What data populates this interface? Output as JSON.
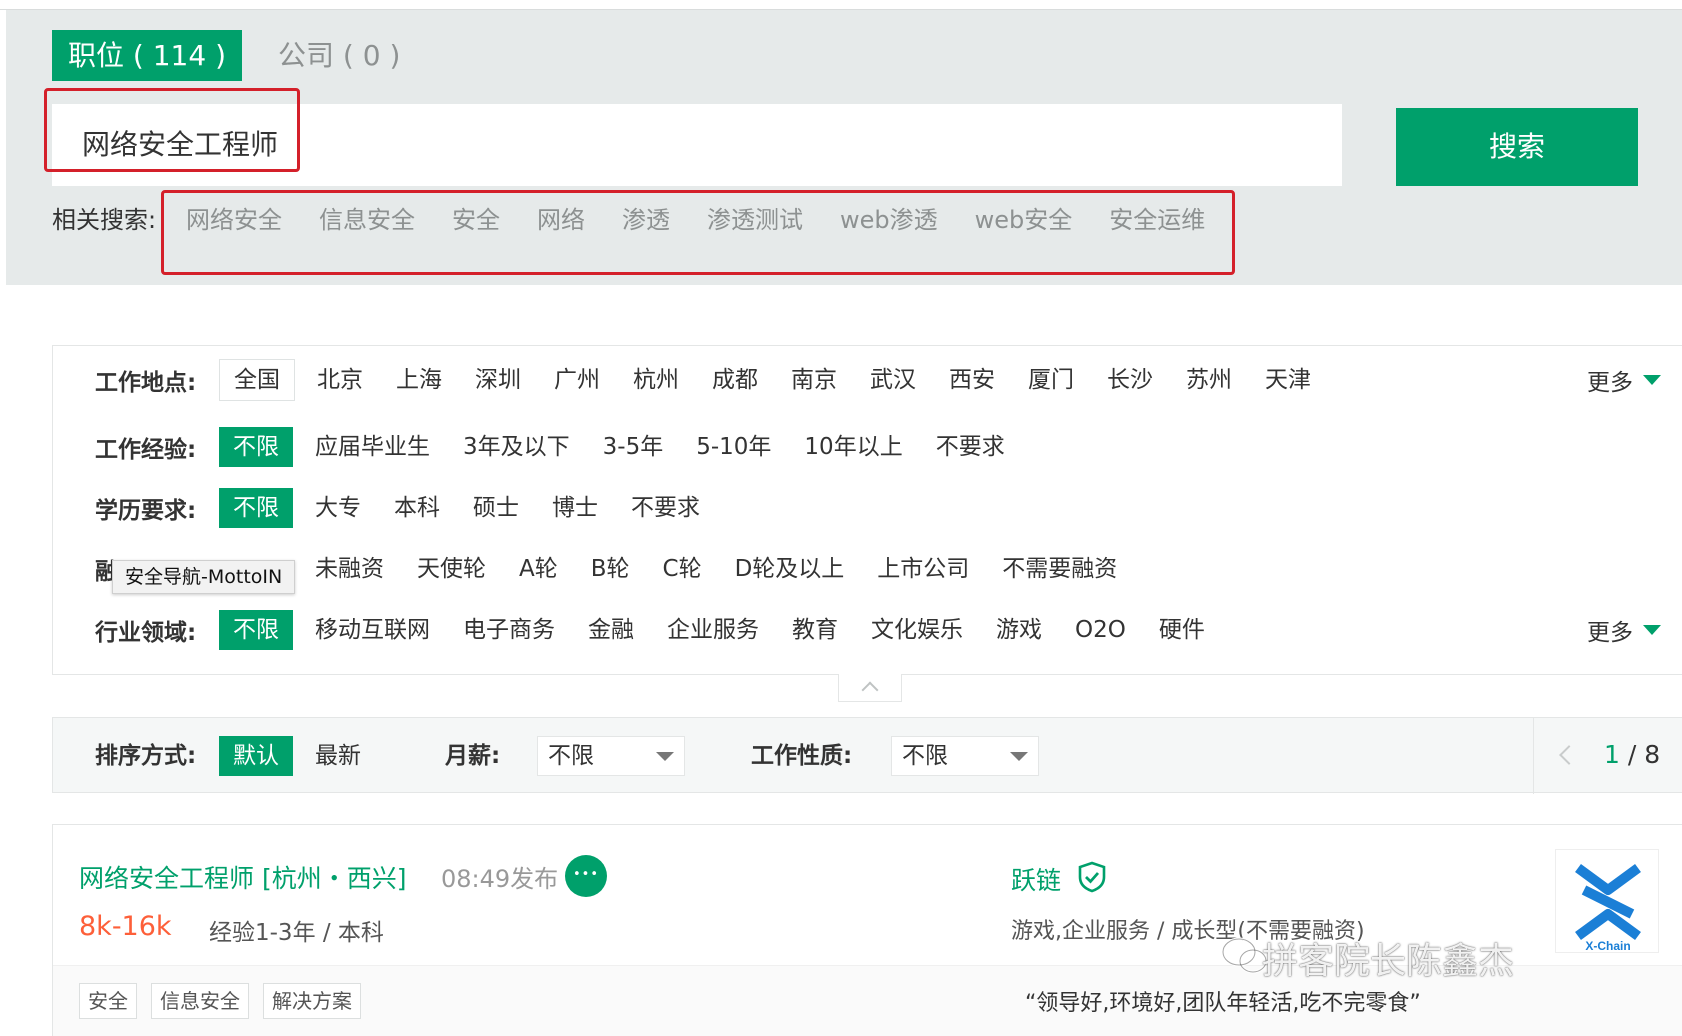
{
  "tabs": [
    {
      "label": "职位 ( 114 )",
      "active": true
    },
    {
      "label": "公司 ( 0 )",
      "active": false
    }
  ],
  "search": {
    "value": "网络安全工程师",
    "button_label": "搜索"
  },
  "related": {
    "label": "相关搜索:",
    "items": [
      "网络安全",
      "信息安全",
      "安全",
      "网络",
      "渗透",
      "渗透测试",
      "web渗透",
      "web安全",
      "安全运维"
    ]
  },
  "filters": {
    "location": {
      "label": "工作地点:",
      "options": [
        "全国",
        "北京",
        "上海",
        "深圳",
        "广州",
        "杭州",
        "成都",
        "南京",
        "武汉",
        "西安",
        "厦门",
        "长沙",
        "苏州",
        "天津"
      ],
      "more": "更多"
    },
    "experience": {
      "label": "工作经验:",
      "options": [
        "不限",
        "应届毕业生",
        "3年及以下",
        "3-5年",
        "5-10年",
        "10年以上",
        "不要求"
      ]
    },
    "education": {
      "label": "学历要求:",
      "options": [
        "不限",
        "大专",
        "本科",
        "硕士",
        "博士",
        "不要求"
      ]
    },
    "financing": {
      "label": "融",
      "options": [
        "未融资",
        "天使轮",
        "A轮",
        "B轮",
        "C轮",
        "D轮及以上",
        "上市公司",
        "不需要融资"
      ]
    },
    "industry": {
      "label": "行业领域:",
      "options": [
        "不限",
        "移动互联网",
        "电子商务",
        "金融",
        "企业服务",
        "教育",
        "文化娱乐",
        "游戏",
        "O2O",
        "硬件"
      ],
      "more": "更多"
    }
  },
  "tooltip": "安全导航-MottoIN",
  "sort": {
    "label": "排序方式:",
    "default": "默认",
    "newest": "最新",
    "salary_label": "月薪:",
    "salary_value": "不限",
    "nature_label": "工作性质:",
    "nature_value": "不限",
    "page_current": "1",
    "page_total": "/ 8"
  },
  "job": {
    "title": "网络安全工程师 [杭州・西兴]",
    "time": "08:49发布",
    "salary": "8k-16k",
    "requirements": "经验1-3年 / 本科",
    "company": "跃链",
    "industry": "游戏,企业服务 / 成长型(不需要融资)",
    "tags": [
      "安全",
      "信息安全",
      "解决方案"
    ],
    "quote": "“领导好,环境好,团队年轻活,吃不完零食”",
    "logo_text": "X-Chain"
  },
  "watermark": "拼客院长陈鑫杰",
  "colors": {
    "accent": "#00a06b",
    "salary": "#fd5f39",
    "highlight": "#d4202a"
  }
}
